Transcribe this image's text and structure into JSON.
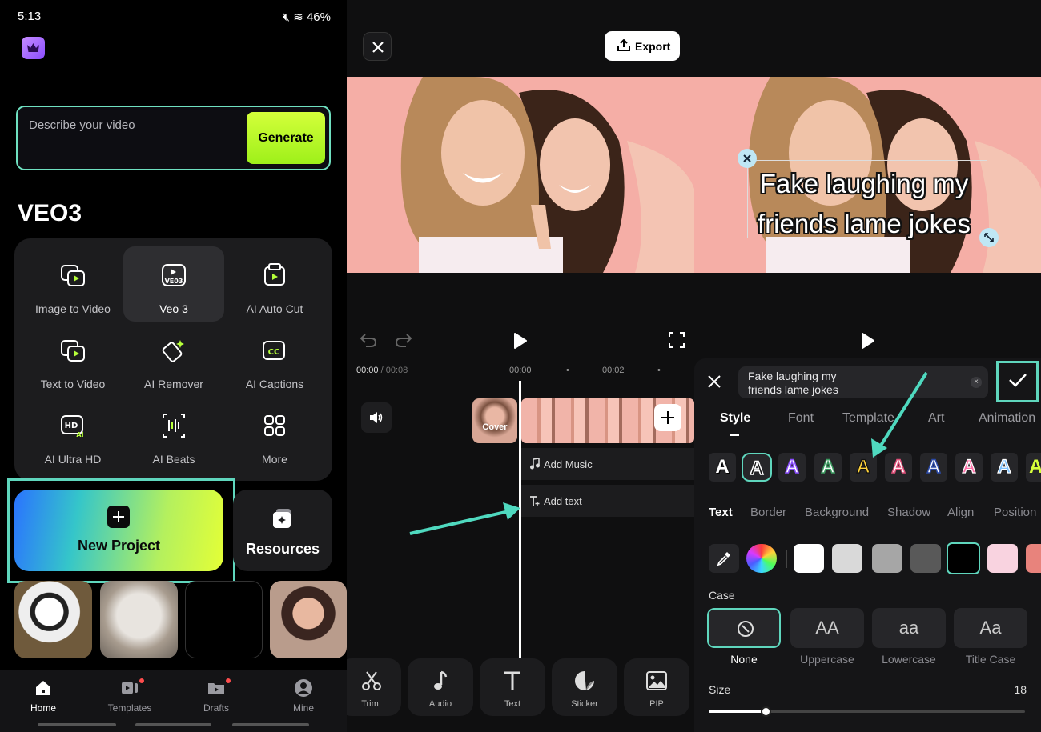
{
  "status_bar": {
    "time": "5:13",
    "battery": "46%"
  },
  "home": {
    "prompt_placeholder": "Describe your video",
    "generate_label": "Generate",
    "section_title": "VEO3",
    "tools": [
      {
        "label": "Image to Video",
        "icon": "image-to-video-icon"
      },
      {
        "label": "Veo 3",
        "icon": "veo3-icon",
        "selected": true
      },
      {
        "label": "AI Auto Cut",
        "icon": "auto-cut-icon"
      },
      {
        "label": "Text to Video",
        "icon": "text-to-video-icon"
      },
      {
        "label": "AI Remover",
        "icon": "eraser-icon"
      },
      {
        "label": "AI Captions",
        "icon": "captions-icon"
      },
      {
        "label": "AI Ultra HD",
        "icon": "hd-icon"
      },
      {
        "label": "AI Beats",
        "icon": "beats-icon"
      },
      {
        "label": "More",
        "icon": "grid-icon"
      }
    ],
    "new_project_label": "New Project",
    "resources_label": "Resources",
    "nav": [
      {
        "label": "Home",
        "active": true
      },
      {
        "label": "Templates"
      },
      {
        "label": "Drafts"
      },
      {
        "label": "Mine"
      }
    ]
  },
  "editor": {
    "export_label": "Export",
    "time_current": "00:00",
    "time_total": "/ 00:08",
    "ruler": [
      "00:00",
      "00:02"
    ],
    "cover_label": "Cover",
    "add_music_label": "Add Music",
    "add_text_label": "Add text",
    "dock": [
      "Trim",
      "Audio",
      "Text",
      "Sticker",
      "PIP"
    ]
  },
  "text_editor": {
    "overlay_line1": "Fake laughing my",
    "overlay_line2": "friends lame jokes",
    "input_line1": "Fake laughing my",
    "input_line2": "friends lame jokes",
    "input_clear": "×",
    "tabs": [
      "Style",
      "Font",
      "Template",
      "Art",
      "Animation"
    ],
    "active_tab": "Style",
    "style_glyph": "A",
    "subtabs": [
      "Text",
      "Border",
      "Background",
      "Shadow",
      "Align",
      "Position"
    ],
    "active_subtab": "Text",
    "colors": [
      "#ffffff",
      "#d9d9d9",
      "#a6a6a6",
      "#595959",
      "#000000",
      "#f9d3e0",
      "#e8837c"
    ],
    "selected_color": "#000000",
    "case_label": "Case",
    "case_options": [
      {
        "glyph": "",
        "name": "None",
        "selected": true
      },
      {
        "glyph": "AA",
        "name": "Uppercase"
      },
      {
        "glyph": "aa",
        "name": "Lowercase"
      },
      {
        "glyph": "Aa",
        "name": "Title Case"
      }
    ],
    "size_label": "Size",
    "size_value": "18",
    "size_fraction": 0.18
  },
  "accent_color": "#5fd6bd"
}
